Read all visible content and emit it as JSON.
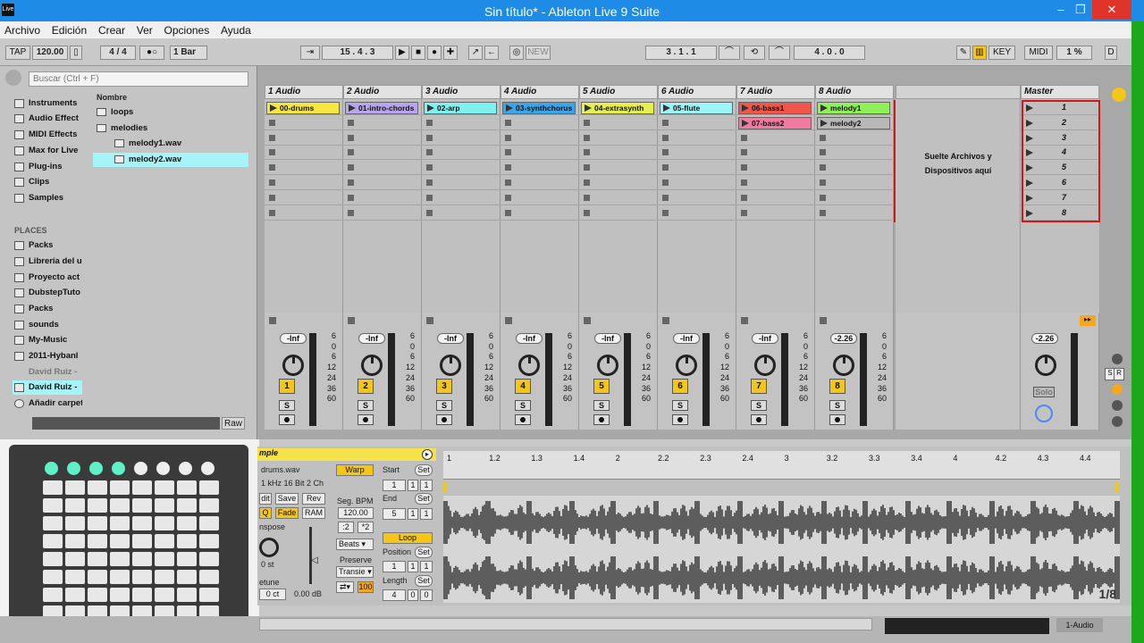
{
  "window": {
    "title": "Sin título* - Ableton Live 9 Suite",
    "app_icon": "Live",
    "min": "–",
    "max": "❐",
    "close": "✕"
  },
  "menu": [
    "Archivo",
    "Edición",
    "Crear",
    "Ver",
    "Opciones",
    "Ayuda"
  ],
  "transport": {
    "tap": "TAP",
    "tempo": "120.00",
    "meter": "4 / 4",
    "quant": "1 Bar",
    "position": "15 .  4 .  3",
    "loop_start": "3 .  1 .  1",
    "loop_len": "4 .  0 .  0",
    "new": "NEW",
    "key": "KEY",
    "midi": "MIDI",
    "cpu": "1 %",
    "d": "D"
  },
  "browser": {
    "search_placeholder": "Buscar (Ctrl + F)",
    "categories": [
      "Instruments",
      "Audio Effect",
      "MIDI Effects",
      "Max for Live",
      "Plug-ins",
      "Clips",
      "Samples"
    ],
    "places_label": "PLACES",
    "places": [
      "Packs",
      "Librería del u",
      "Proyecto act",
      "DubstepTuto",
      "Packs",
      "sounds",
      "My-Music",
      "2011-Hybanl",
      "David Ruiz -",
      "David Ruiz -",
      "Añadir carpet"
    ],
    "col_header": "Nombre",
    "files": [
      "loops",
      "melodies",
      "melody1.wav",
      "melody2.wav"
    ],
    "raw": "Raw"
  },
  "tracks": [
    {
      "name": "1 Audio",
      "clips": [
        {
          "name": "00-drums",
          "color": "#f5e642"
        }
      ],
      "vol": "-Inf",
      "num": "1"
    },
    {
      "name": "2 Audio",
      "clips": [
        {
          "name": "01-intro-chords",
          "color": "#b9a4ee"
        }
      ],
      "vol": "-Inf",
      "num": "2"
    },
    {
      "name": "3 Audio",
      "clips": [
        {
          "name": "02-arp",
          "color": "#7ff1f1"
        }
      ],
      "vol": "-Inf",
      "num": "3"
    },
    {
      "name": "4 Audio",
      "clips": [
        {
          "name": "03-synthchorus",
          "color": "#3aa6e9"
        }
      ],
      "vol": "-Inf",
      "num": "4"
    },
    {
      "name": "5 Audio",
      "clips": [
        {
          "name": "04-extrasynth",
          "color": "#e7ef4e"
        }
      ],
      "vol": "-Inf",
      "num": "5"
    },
    {
      "name": "6 Audio",
      "clips": [
        {
          "name": "05-flute",
          "color": "#9df4f6"
        }
      ],
      "vol": "-Inf",
      "num": "6"
    },
    {
      "name": "7 Audio",
      "clips": [
        {
          "name": "06-bass1",
          "color": "#f0564a"
        },
        {
          "name": "07-bass2",
          "color": "#f07aa0"
        }
      ],
      "vol": "-Inf",
      "num": "7"
    },
    {
      "name": "8 Audio",
      "clips": [
        {
          "name": "melody1",
          "color": "#8ff05a"
        },
        {
          "name": "melody2",
          "color": "#b8b8b8"
        }
      ],
      "vol": "-2.26",
      "num": "8"
    }
  ],
  "drop_zone": "Suelte Archivos y Dispositivos aquí",
  "master": {
    "name": "Master",
    "scenes": [
      "1",
      "2",
      "3",
      "4",
      "5",
      "6",
      "7",
      "8"
    ],
    "vol": "-2.26",
    "solo": "Solo"
  },
  "meter_scale": [
    "6",
    "0",
    "6",
    "12",
    "24",
    "36",
    "60"
  ],
  "clip_view": {
    "header": "mple",
    "file": "drums.wav",
    "info": "1 kHz 16 Bit 2 Ch",
    "warp": "Warp",
    "save": "Save",
    "rev": "Rev",
    "edit": "dit",
    "fade": "Fade",
    "ram": "RAM",
    "hq": "Q",
    "seg_bpm_label": "Seg. BPM",
    "seg_bpm": "120.00",
    "div2": ":2",
    "x2": "*2",
    "transpose": "nspose",
    "transpose_val": "0 st",
    "detune": "etune",
    "detune_val": "0 ct",
    "gain": "0.00 dB",
    "warp_mode": "Beats",
    "preserve": "Preserve",
    "transient": "Transie",
    "val100": "100",
    "start": "Start",
    "end": "End",
    "loop": "Loop",
    "position": "Position",
    "length": "Length",
    "set": "Set",
    "start_vals": [
      "1",
      "1",
      "1"
    ],
    "end_vals": [
      "5",
      "1",
      "1"
    ],
    "pos_vals": [
      "1",
      "1",
      "1"
    ],
    "len_vals": [
      "4",
      "0",
      "0"
    ],
    "ruler": [
      "1",
      "1.2",
      "1.3",
      "1.4",
      "2",
      "2.2",
      "2.3",
      "2.4",
      "3",
      "3.2",
      "3.3",
      "3.4",
      "4",
      "4.2",
      "4.3",
      "4.4"
    ],
    "zoom": "1/8"
  },
  "status": {
    "track": "1-Audio"
  }
}
